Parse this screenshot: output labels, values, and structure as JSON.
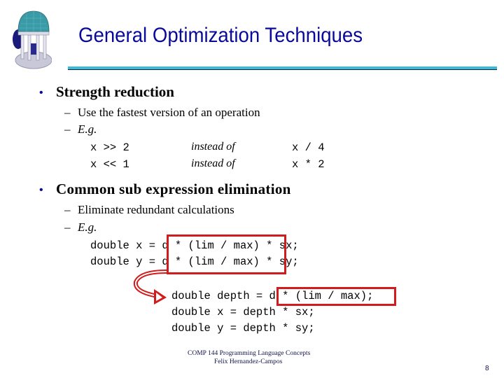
{
  "slide": {
    "title": "General Optimization Techniques",
    "logo_icon": "old-well-rotunda-logo",
    "accent_color": "#0a0a9a",
    "rule_color": "#3cb8d8",
    "highlight_color": "#d01c1c",
    "bullet_glyph": "•",
    "dash_glyph": "–",
    "sections": [
      {
        "heading": "Strength reduction",
        "items": [
          {
            "text": "Use the fastest version of an operation"
          },
          {
            "text": "E.g."
          }
        ],
        "examples": [
          {
            "fast": "x >> 2",
            "connector": "instead of",
            "slow": "x / 4"
          },
          {
            "fast": "x << 1",
            "connector": "instead of",
            "slow": "x * 2"
          }
        ]
      },
      {
        "heading": "Common sub expression elimination",
        "items": [
          {
            "text": "Eliminate redundant calculations"
          },
          {
            "text": "E.g."
          }
        ],
        "before_code": [
          {
            "prefix": "double x = ",
            "common": "d * (lim / max)",
            "suffix": " * sx;"
          },
          {
            "prefix": "double y = ",
            "common": "d * (lim / max)",
            "suffix": " * sy;"
          }
        ],
        "after_code": [
          {
            "prefix": "double depth = ",
            "common": "d * (lim / max)",
            "suffix": ";"
          },
          {
            "prefix": "double x = depth * sx;",
            "common": "",
            "suffix": ""
          },
          {
            "prefix": "double y = depth * sy;",
            "common": "",
            "suffix": ""
          }
        ],
        "arrow_icon": "curved-arrow-icon"
      }
    ],
    "footer": {
      "course": "COMP 144 Programming Language Concepts",
      "author": "Felix Hernandez-Campos",
      "page_number": "8"
    }
  }
}
